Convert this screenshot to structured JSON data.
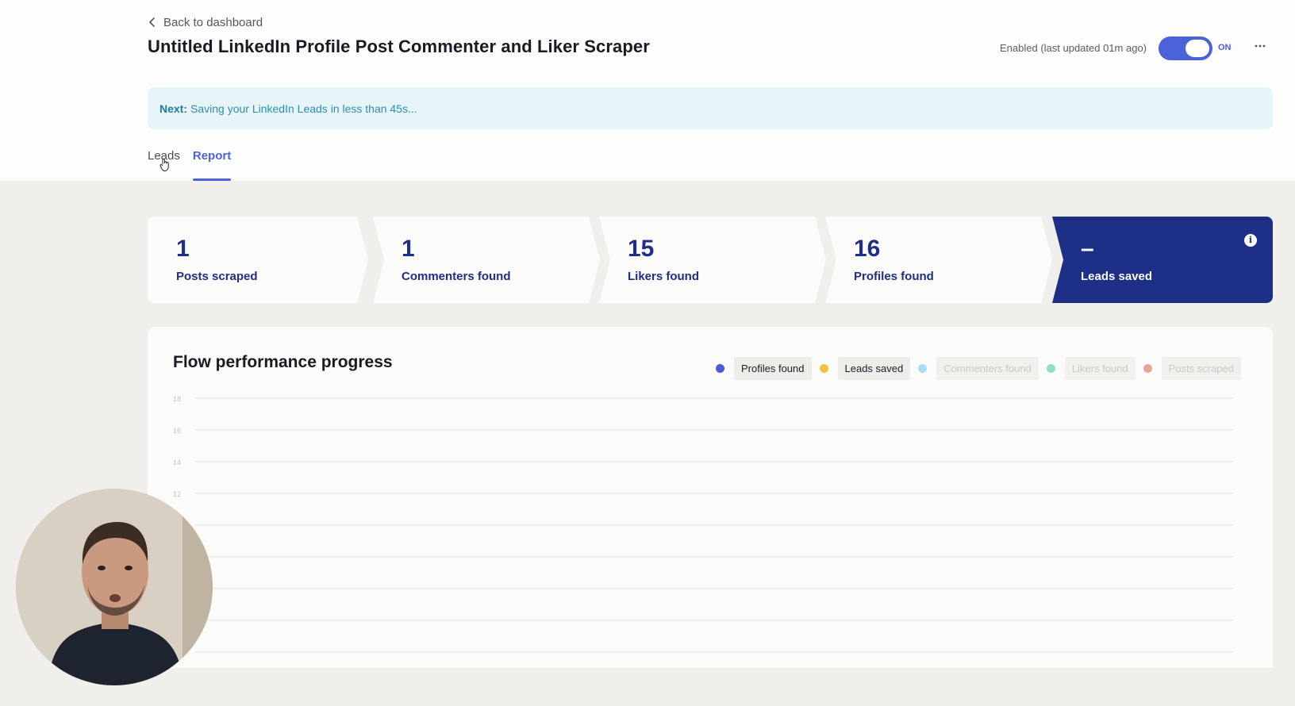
{
  "header": {
    "back_label": "Back to dashboard",
    "title": "Untitled LinkedIn Profile Post Commenter and Liker Scraper",
    "status_text": "Enabled (last updated 01m ago)",
    "toggle_label": "ON",
    "more_icon": "ellipsis-icon"
  },
  "banner": {
    "prefix": "Next:",
    "message": "Saving your LinkedIn Leads in less than 45s..."
  },
  "tabs": [
    {
      "label": "Leads",
      "active": false
    },
    {
      "label": "Report",
      "active": true
    }
  ],
  "stats": [
    {
      "value": "1",
      "label": "Posts scraped"
    },
    {
      "value": "1",
      "label": "Commenters found"
    },
    {
      "value": "15",
      "label": "Likers found"
    },
    {
      "value": "16",
      "label": "Profiles found"
    },
    {
      "value": "–",
      "label": "Leads saved"
    }
  ],
  "chart": {
    "title": "Flow performance progress",
    "legend": [
      {
        "label": "Profiles found",
        "color": "#4a5bd4",
        "active": true
      },
      {
        "label": "Leads saved",
        "color": "#f3c43a",
        "active": true
      },
      {
        "label": "Commenters found",
        "color": "#a9def5",
        "active": false
      },
      {
        "label": "Likers found",
        "color": "#8ee0c6",
        "active": false
      },
      {
        "label": "Posts scraped",
        "color": "#f0a19a",
        "active": false
      }
    ]
  },
  "chart_data": {
    "type": "line",
    "title": "Flow performance progress",
    "y_ticks": [
      18,
      16,
      14,
      12
    ],
    "ylim": [
      0,
      18
    ],
    "grid": true,
    "legend_position": "top-right",
    "series": [
      {
        "name": "Profiles found",
        "values": []
      },
      {
        "name": "Leads saved",
        "values": []
      },
      {
        "name": "Commenters found",
        "values": []
      },
      {
        "name": "Likers found",
        "values": []
      },
      {
        "name": "Posts scraped",
        "values": []
      }
    ]
  },
  "colors": {
    "accent": "#4a63d8",
    "navy": "#1d2f86",
    "banner_bg": "#e7f4f8"
  }
}
